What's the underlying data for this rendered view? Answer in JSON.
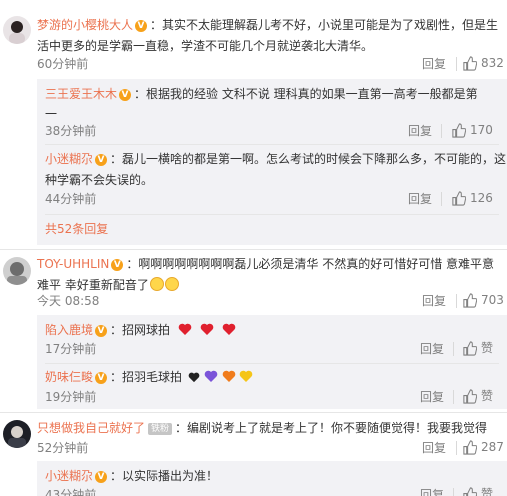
{
  "comments": [
    {
      "user": "梦游的小樱桃大人",
      "text_line1": "其实不太能理解磊儿考不好，小说里可能是为了戏剧性，但是生",
      "text_line2": "活中更多的是学霸一直稳，学渣不可能几个月就逆袭北大清华。",
      "time": "60分钟前",
      "reply": "回复",
      "likes": "832",
      "replies": [
        {
          "user": "三王爱王木木",
          "text_line1": "根据我的经验  文科不说  理科真的如果一直第一高考一般都是第",
          "text_line2": "一",
          "time": "38分钟前",
          "reply": "回复",
          "likes": "170"
        },
        {
          "user": "小迷糊尕",
          "text_line1": "磊儿一横啥的都是第一啊。怎么考试的时候会下降那么多，不可能的，这",
          "text_line2": "种学霸不会失误的。",
          "time": "44分钟前",
          "reply": "回复",
          "likes": "126"
        }
      ],
      "more_replies": "共52条回复"
    },
    {
      "user": "TOY-UHHLIN",
      "text_line1": "啊啊啊啊啊啊啊啊磊儿必须是清华 不然真的好可惜好可惜 意难平意",
      "text_line2": "难平 幸好重新配音了",
      "time": "今天 08:58",
      "reply": "回复",
      "likes": "703",
      "replies": [
        {
          "user": "陷入鹿境",
          "text_line1": "招网球拍",
          "time": "17分钟前",
          "reply": "回复",
          "likes": "赞"
        },
        {
          "user": "奶味仨畯",
          "text_line1": "招羽毛球拍",
          "time": "19分钟前",
          "reply": "回复",
          "likes": "赞"
        }
      ]
    },
    {
      "user": "只想做我自己就好了",
      "badge": "铁粉",
      "text_line1": "编剧说考上了就是考上了！你不要随便觉得！我要我觉得",
      "time": "52分钟前",
      "reply": "回复",
      "likes": "287",
      "replies": [
        {
          "user": "小迷糊尕",
          "text_line1": "以实际播出为准！",
          "time": "43分钟前",
          "reply": "回复",
          "likes": "赞"
        }
      ]
    }
  ],
  "colors": {
    "username": "#eb7350",
    "meta": "#808080",
    "subbox": "#f2f2f5"
  },
  "icons": [
    "like-thumb-icon",
    "verified-badge-icon",
    "heart-icon",
    "smiley-icon"
  ]
}
